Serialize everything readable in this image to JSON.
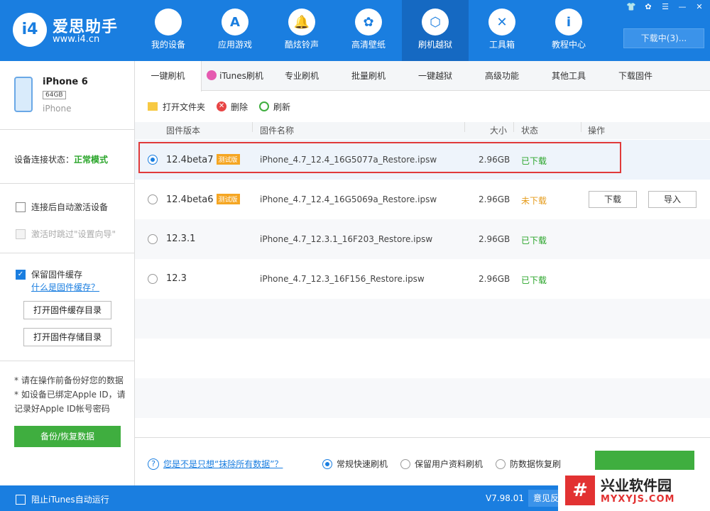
{
  "app": {
    "logo_text": "i4",
    "name": "爱思助手",
    "url": "www.i4.cn"
  },
  "nav": [
    {
      "label": "我的设备",
      "icon": "apple-icon",
      "glyph": ""
    },
    {
      "label": "应用游戏",
      "icon": "app-store-icon",
      "glyph": "A"
    },
    {
      "label": "酷炫铃声",
      "icon": "bell-icon",
      "glyph": "🔔"
    },
    {
      "label": "高清壁纸",
      "icon": "flower-icon",
      "glyph": "✿"
    },
    {
      "label": "刷机越狱",
      "icon": "box-icon",
      "glyph": "⬡"
    },
    {
      "label": "工具箱",
      "icon": "tools-icon",
      "glyph": "✕"
    },
    {
      "label": "教程中心",
      "icon": "info-icon",
      "glyph": "i"
    }
  ],
  "window_controls": [
    "👕",
    "✿",
    "☰",
    "—",
    "✕"
  ],
  "download_label": "下载中(3)...",
  "device": {
    "name": "iPhone 6",
    "capacity": "64GB",
    "type": "iPhone",
    "status_label": "设备连接状态：",
    "status_value": "正常模式"
  },
  "sidebar": {
    "auto_activate": "连接后自动激活设备",
    "skip_setup": "激活时跳过\"设置向导\"",
    "keep_cache": "保留固件缓存",
    "what_is_cache": "什么是固件缓存？",
    "open_cache_dir": "打开固件缓存目录",
    "open_store_dir": "打开固件存储目录",
    "note1": "* 请在操作前备份好您的数据",
    "note2": "* 如设备已绑定Apple ID，请记录好Apple ID帐号密码",
    "backup_btn": "备份/恢复数据"
  },
  "tabs": [
    "一键刷机",
    "iTunes刷机",
    "专业刷机",
    "批量刷机",
    "一键越狱",
    "高级功能",
    "其他工具",
    "下载固件"
  ],
  "toolbar": {
    "open_folder": "打开文件夹",
    "delete": "删除",
    "refresh": "刷新"
  },
  "table": {
    "headers": {
      "version": "固件版本",
      "name": "固件名称",
      "size": "大小",
      "status": "状态",
      "action": "操作"
    },
    "beta_badge": "测试版",
    "rows": [
      {
        "version": "12.4beta7",
        "beta": true,
        "name": "iPhone_4.7_12.4_16G5077a_Restore.ipsw",
        "size": "2.96GB",
        "status": "已下载",
        "downloaded": true,
        "selected": true
      },
      {
        "version": "12.4beta6",
        "beta": true,
        "name": "iPhone_4.7_12.4_16G5069a_Restore.ipsw",
        "size": "2.96GB",
        "status": "未下载",
        "downloaded": false,
        "selected": false
      },
      {
        "version": "12.3.1",
        "beta": false,
        "name": "iPhone_4.7_12.3.1_16F203_Restore.ipsw",
        "size": "2.96GB",
        "status": "已下载",
        "downloaded": true,
        "selected": false
      },
      {
        "version": "12.3",
        "beta": false,
        "name": "iPhone_4.7_12.3_16F156_Restore.ipsw",
        "size": "2.96GB",
        "status": "已下载",
        "downloaded": true,
        "selected": false
      }
    ],
    "download_btn": "下载",
    "import_btn": "导入"
  },
  "bottom": {
    "help_text": "您是不是只想“抹除所有数据”？",
    "mode_quick": "常规快速刷机",
    "mode_keep": "保留用户资料刷机",
    "mode_recover": "防数据恢复刷"
  },
  "statusbar": {
    "block_itunes": "阻止iTunes自动运行",
    "version": "V7.98.01",
    "feedback": "意见反"
  },
  "watermark": {
    "logo": "#",
    "name": "兴业软件园",
    "url": "MYXYJS.COM"
  },
  "colors": {
    "brand": "#1a7ee0",
    "ok": "#2aa52a",
    "warn": "#e59b1a",
    "danger": "#e03a3a"
  }
}
